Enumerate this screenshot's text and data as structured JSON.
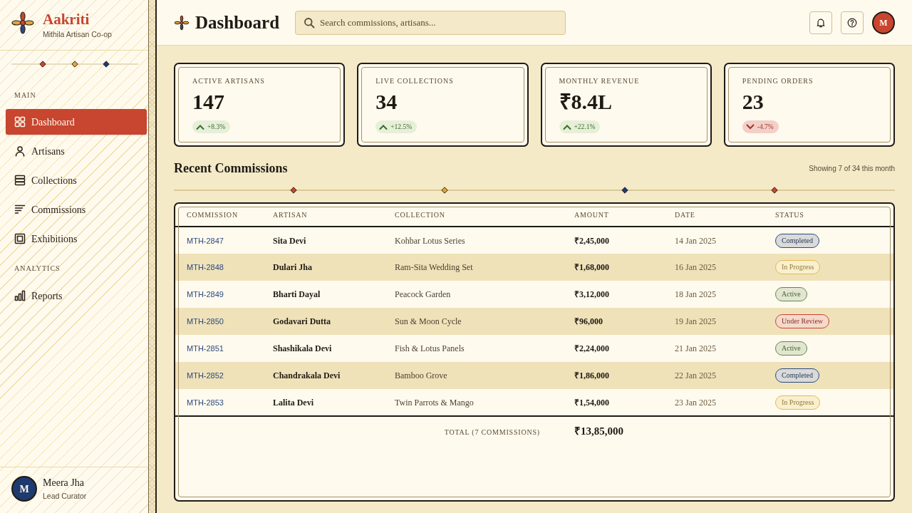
{
  "sidebar": {
    "brand": {
      "name": "Aakriti",
      "tagline": "Mithila Artisan Co-op"
    },
    "sections": [
      {
        "title": "MAIN",
        "items": [
          {
            "label": "Dashboard",
            "selected": true
          },
          {
            "label": "Artisans",
            "selected": false
          },
          {
            "label": "Collections",
            "selected": false
          },
          {
            "label": "Commissions",
            "selected": false
          },
          {
            "label": "Exhibitions",
            "selected": false
          }
        ]
      },
      {
        "title": "ANALYTICS",
        "items": [
          {
            "label": "Reports",
            "selected": false
          }
        ]
      }
    ],
    "user": {
      "initial": "M",
      "name": "Meera Jha",
      "role": "Lead Curator"
    }
  },
  "header": {
    "title": "Dashboard",
    "search": {
      "placeholder": "Search commissions, artisans..."
    },
    "avatar_initial": "M"
  },
  "stats": [
    {
      "label": "ACTIVE ARTISANS",
      "value": "147",
      "delta": "+8.3%",
      "kind": "up"
    },
    {
      "label": "LIVE COLLECTIONS",
      "value": "34",
      "delta": "+12.5%",
      "kind": "up"
    },
    {
      "label": "MONTHLY REVENUE",
      "value": "₹8.4L",
      "delta": "+22.1%",
      "kind": "up"
    },
    {
      "label": "PENDING ORDERS",
      "value": "23",
      "delta": "-4.7%",
      "kind": "down"
    }
  ],
  "commissions": {
    "title": "Recent Commissions",
    "summary": "Showing 7 of 34 this month",
    "columns": [
      "COMMISSION",
      "ARTISAN",
      "COLLECTION",
      "AMOUNT",
      "DATE",
      "STATUS"
    ],
    "rows": [
      {
        "commission": "MTH-2847",
        "artisan": "Sita Devi",
        "collection": "Kohbar Lotus Series",
        "amount": "₹2,45,000",
        "date": "14 Jan 2025",
        "status": {
          "label": "Completed",
          "color": "#2c4a7e"
        }
      },
      {
        "commission": "MTH-2848",
        "artisan": "Dulari Jha",
        "collection": "Ram-Sita Wedding Set",
        "amount": "₹1,68,000",
        "date": "16 Jan 2025",
        "status": {
          "label": "In Progress",
          "color": "#e0bc4a"
        }
      },
      {
        "commission": "MTH-2849",
        "artisan": "Bharti Dayal",
        "collection": "Peacock Garden",
        "amount": "₹3,12,000",
        "date": "18 Jan 2025",
        "status": {
          "label": "Active",
          "color": "#5e8a48"
        }
      },
      {
        "commission": "MTH-2850",
        "artisan": "Godavari Dutta",
        "collection": "Sun & Moon Cycle",
        "amount": "₹96,000",
        "date": "19 Jan 2025",
        "status": {
          "label": "Under Review",
          "color": "#c8452f"
        }
      },
      {
        "commission": "MTH-2851",
        "artisan": "Shashikala Devi",
        "collection": "Fish & Lotus Panels",
        "amount": "₹2,24,000",
        "date": "21 Jan 2025",
        "status": {
          "label": "Active",
          "color": "#5e8a48"
        }
      },
      {
        "commission": "MTH-2852",
        "artisan": "Chandrakala Devi",
        "collection": "Bamboo Grove",
        "amount": "₹1,86,000",
        "date": "22 Jan 2025",
        "status": {
          "label": "Completed",
          "color": "#2c4a7e"
        }
      },
      {
        "commission": "MTH-2853",
        "artisan": "Lalita Devi",
        "collection": "Twin Parrots & Mango",
        "amount": "₹1,54,000",
        "date": "23 Jan 2025",
        "status": {
          "label": "In Progress",
          "color": "#e0bc4a"
        }
      }
    ],
    "total_label": "TOTAL (7 COMMISSIONS)",
    "total": "₹13,85,000"
  }
}
